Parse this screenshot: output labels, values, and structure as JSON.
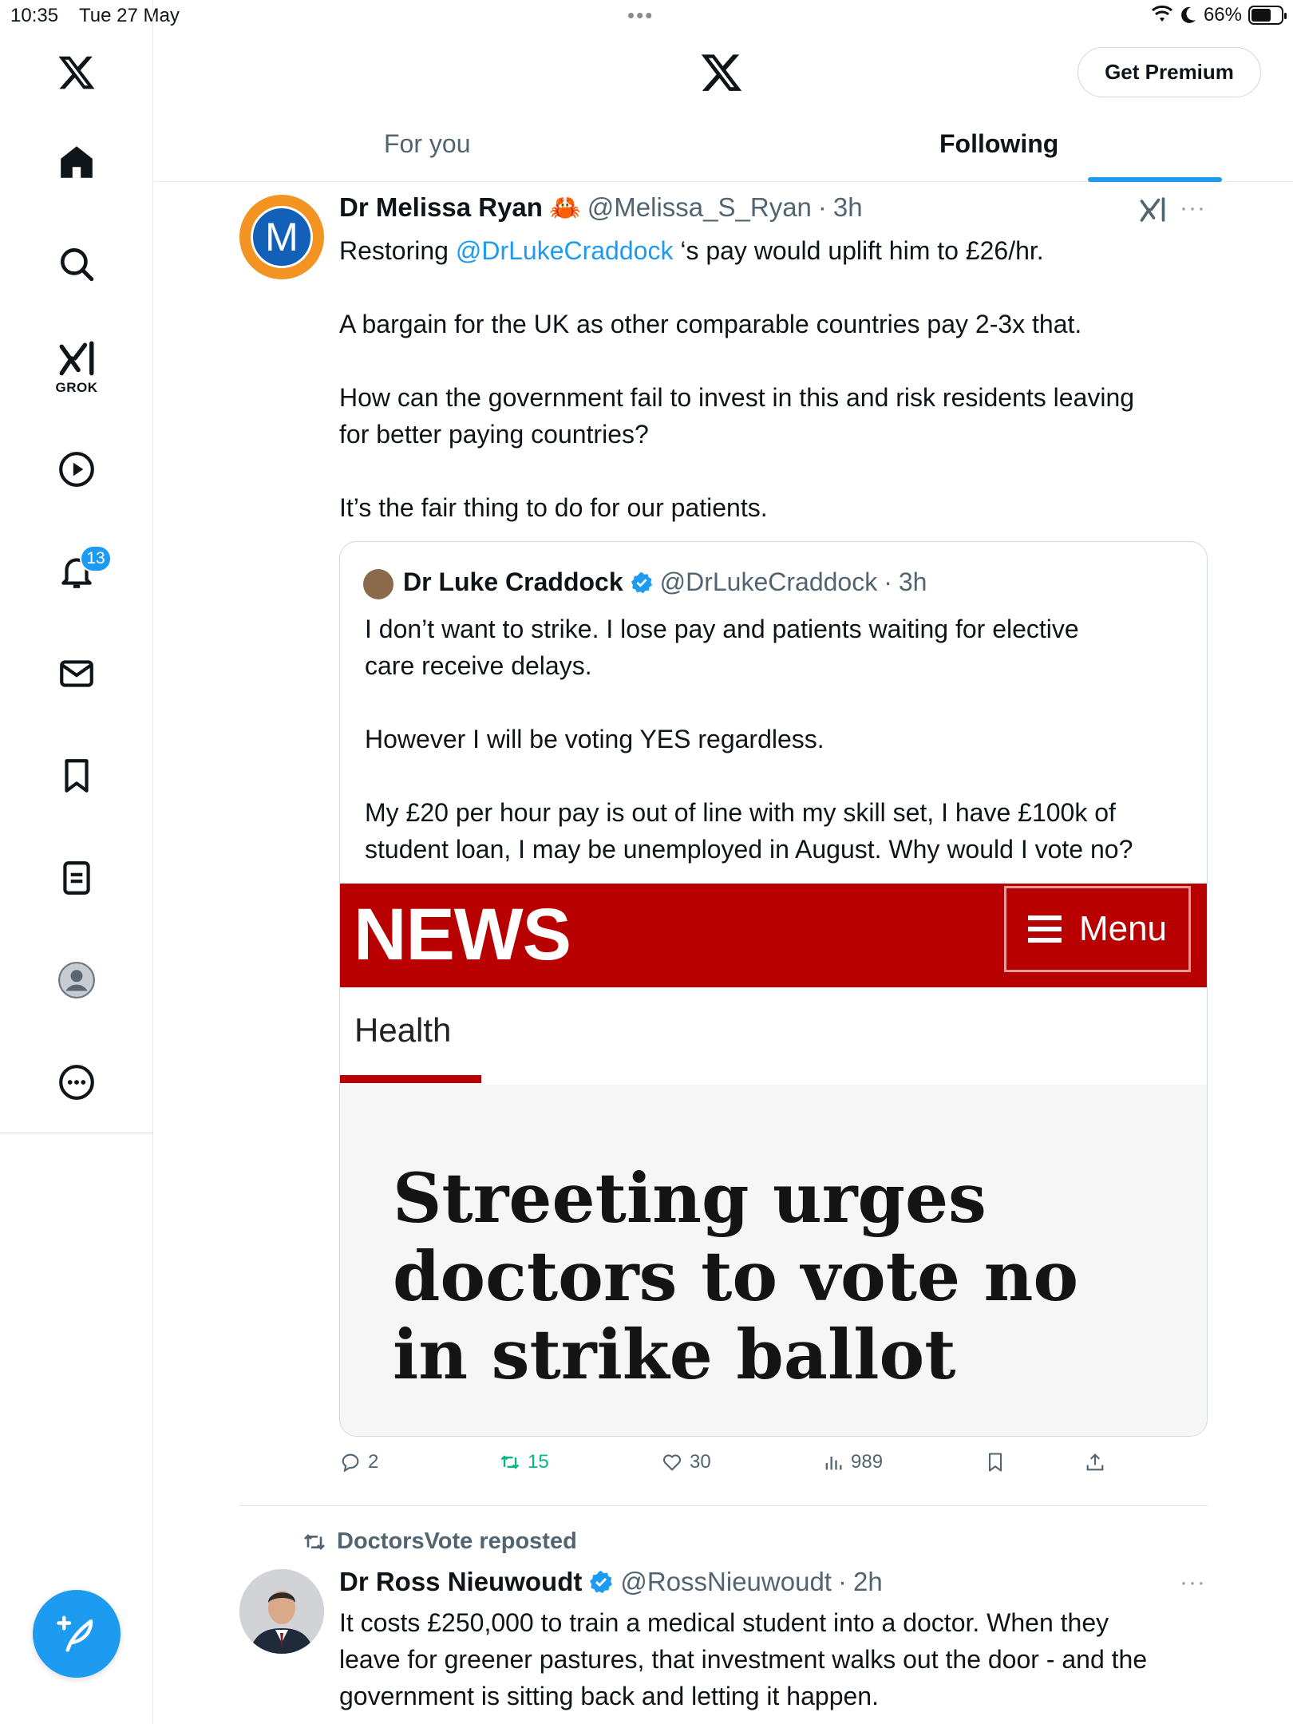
{
  "status_bar": {
    "time": "10:35",
    "date": "Tue 27 May",
    "battery": "66%"
  },
  "sidebar": {
    "grok_label": "GROK",
    "notifications_badge": "13"
  },
  "header": {
    "premium_label": "Get Premium"
  },
  "tabs": [
    {
      "label": "For you"
    },
    {
      "label": "Following"
    }
  ],
  "tweet1": {
    "name": "Dr Melissa Ryan",
    "emoji": "🦀",
    "handle": "@Melissa_S_Ryan",
    "time": "3h",
    "text_prefix": "Restoring ",
    "mention": "@DrLukeCraddock",
    "text_suffix": " ‘s pay would uplift him to £26/hr.",
    "text_body": "A bargain for the UK as other comparable countries pay 2-3x that.\n\nHow can the government fail to invest in this and risk residents leaving\nfor better paying countries?\n\nIt’s the fair thing to do for our patients.",
    "quote": {
      "name": "Dr Luke Craddock",
      "handle": "@DrLukeCraddock",
      "time": "3h",
      "text": "I don’t want to strike. I lose pay and patients waiting for elective\ncare receive delays.\n\nHowever I will be voting YES regardless.\n\nMy £20 per hour pay is out of line with my skill set, I have £100k of\nstudent loan, I may be unemployed in August. Why would I vote no?",
      "image": {
        "brand": "NEWS",
        "menu_label": "Menu",
        "section": "Health",
        "headline": "Streeting urges doctors to vote no in strike ballot"
      }
    },
    "stats": {
      "replies": "2",
      "reposts": "15",
      "likes": "30",
      "views": "989"
    }
  },
  "tweet2": {
    "repost_label": "DoctorsVote reposted",
    "name": "Dr Ross Nieuwoudt",
    "handle": "@RossNieuwoudt",
    "time": "2h",
    "text": "It costs £250,000 to train a medical student into a doctor. When they\nleave for greener pastures, that investment walks out the door - and the\ngovernment is sitting back and letting it happen."
  },
  "colors": {
    "accent": "#1d9bf0",
    "bbc_red": "#b80000",
    "repost_green": "#00ba7c"
  }
}
